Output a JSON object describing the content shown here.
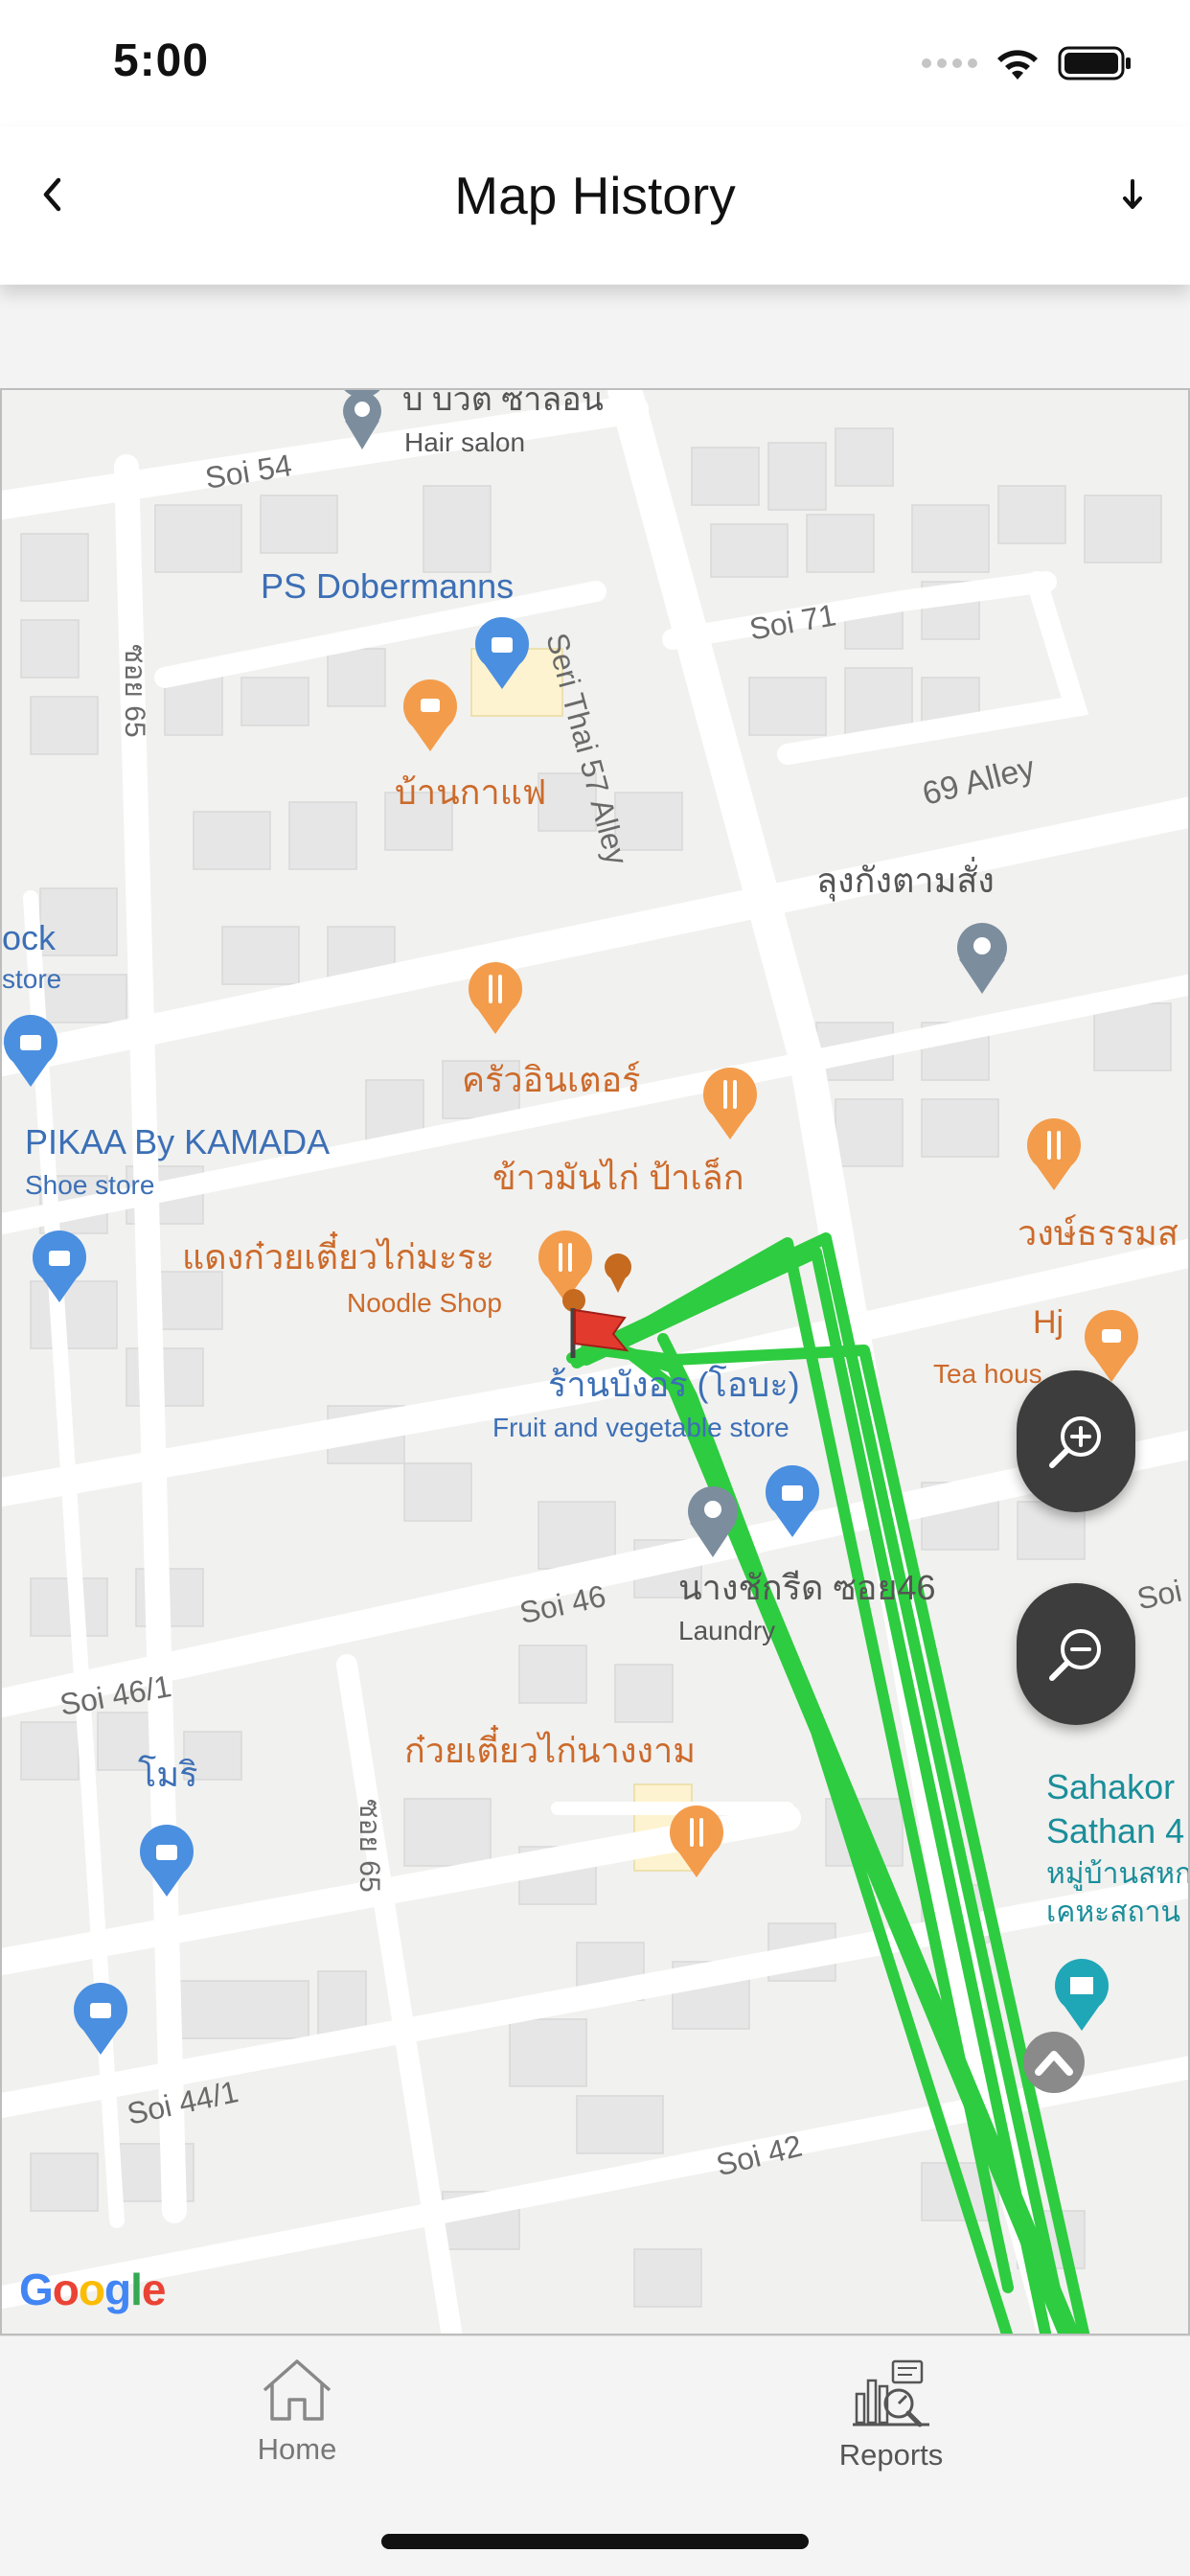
{
  "status_bar": {
    "time": "5:00",
    "icons": [
      "signal-icon",
      "wifi-icon",
      "battery-icon"
    ]
  },
  "nav": {
    "title": "Map History",
    "back_icon": "chevron-left-icon",
    "download_icon": "download-arrow-icon"
  },
  "map": {
    "roads": [
      "Soi 54",
      "Soi 71",
      "Seri Thai 57 Alley",
      "69 Alley",
      "ซอย 65",
      "Soi 46",
      "Soi 46/1",
      "ซอย 65",
      "Soi 44/1",
      "Soi 42",
      "Soi"
    ],
    "places": [
      {
        "name": "บ บวต ซาลอน",
        "category": "Hair salon"
      },
      {
        "name": "PS Dobermanns",
        "category": ""
      },
      {
        "name": "บ้านกาแฟ",
        "category": ""
      },
      {
        "name": "ลุงกังตามสั่ง",
        "category": ""
      },
      {
        "name": "ock",
        "category": "store"
      },
      {
        "name": "ครัวอินเตอร์",
        "category": ""
      },
      {
        "name": "PIKAA By KAMADA",
        "category": "Shoe store"
      },
      {
        "name": "ข้าวมันไก่ ป้าเล็ก",
        "category": ""
      },
      {
        "name": "แดงก๋วยเตี๋ยวไก่มะระ",
        "category": "Noodle Shop"
      },
      {
        "name": "วงษ์ธรรมส",
        "category": ""
      },
      {
        "name": "Hj",
        "category": "Tea hous"
      },
      {
        "name": "ร้านบังอร (โอบะ)",
        "category": "Fruit and vegetable store"
      },
      {
        "name": "นางชักรีด ซอย46",
        "category": "Laundry"
      },
      {
        "name": "โมริ",
        "category": ""
      },
      {
        "name": "ก๋วยเตี๋ยวไก่นางงาม",
        "category": ""
      },
      {
        "name": "Sahakor",
        "category": ""
      },
      {
        "name": "Sathan 4",
        "category": ""
      },
      {
        "name": "หมู่บ้านสหก",
        "category": ""
      },
      {
        "name": "เคหะสถาน",
        "category": ""
      }
    ],
    "attribution": [
      "G",
      "o",
      "o",
      "g",
      "l",
      "e"
    ],
    "route_color": "#2ecc40",
    "zoom_in_icon": "zoom-in-magnifier-icon",
    "zoom_out_icon": "zoom-out-magnifier-icon"
  },
  "tabs": [
    {
      "label": "Home",
      "icon": "home-icon"
    },
    {
      "label": "Reports",
      "icon": "reports-icon"
    }
  ]
}
